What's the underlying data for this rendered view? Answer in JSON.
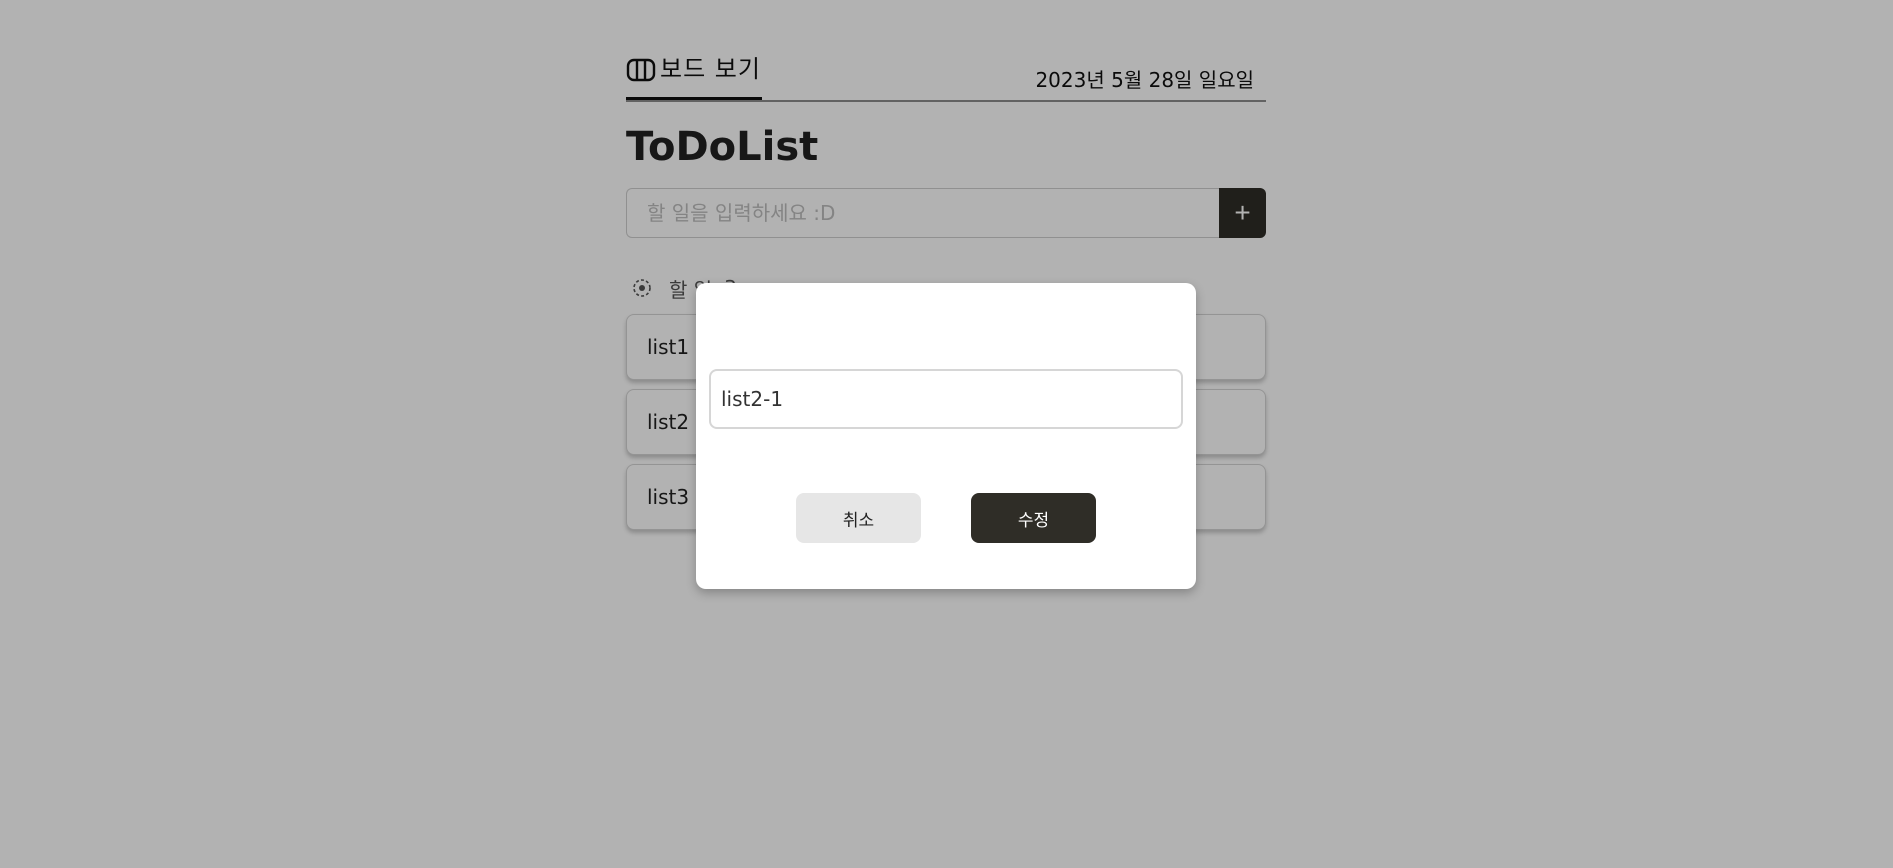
{
  "header": {
    "tab_label": "보드 보기",
    "date": "2023년 5월 28일 일요일"
  },
  "main": {
    "title": "ToDoList",
    "new_todo": {
      "placeholder": "할 일을 입력하세요 :D",
      "add_label": "+"
    },
    "section": {
      "label": "할 일",
      "count": "3"
    },
    "items": [
      {
        "label": "list1"
      },
      {
        "label": "list2"
      },
      {
        "label": "list3"
      }
    ]
  },
  "modal": {
    "input_value": "list2-1",
    "cancel_label": "취소",
    "edit_label": "수정"
  },
  "colors": {
    "primary": "#2f2d27",
    "overlay": "rgba(0,0,0,0.30)",
    "cancel_bg": "#e6e6e6"
  },
  "icons": {
    "board_tab": "board-view-icon",
    "section": "todo-status-icon",
    "add": "plus"
  }
}
